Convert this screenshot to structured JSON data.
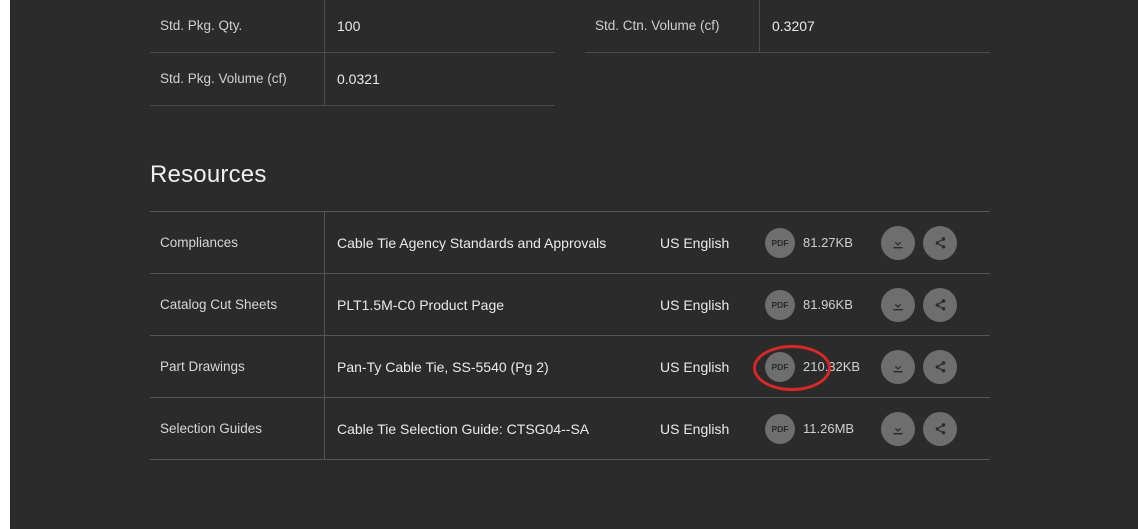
{
  "specs": {
    "left": [
      {
        "label": "Std. Pkg. Qty.",
        "value": "100"
      },
      {
        "label": "Std. Pkg. Volume (cf)",
        "value": "0.0321"
      }
    ],
    "right": [
      {
        "label": "Std. Ctn. Volume (cf)",
        "value": "0.3207"
      }
    ]
  },
  "resources": {
    "heading": "Resources",
    "badge_label": "PDF",
    "items": [
      {
        "category": "Compliances",
        "title": "Cable Tie Agency Standards and Approvals",
        "language": "US English",
        "size": "81.27KB"
      },
      {
        "category": "Catalog Cut Sheets",
        "title": "PLT1.5M-C0 Product Page",
        "language": "US English",
        "size": "81.96KB"
      },
      {
        "category": "Part Drawings",
        "title": "Pan-Ty Cable Tie, SS-5540 (Pg 2)",
        "language": "US English",
        "size": "210.32KB"
      },
      {
        "category": "Selection Guides",
        "title": "Cable Tie Selection Guide: CTSG04--SA",
        "language": "US English",
        "size": "11.26MB"
      }
    ]
  }
}
